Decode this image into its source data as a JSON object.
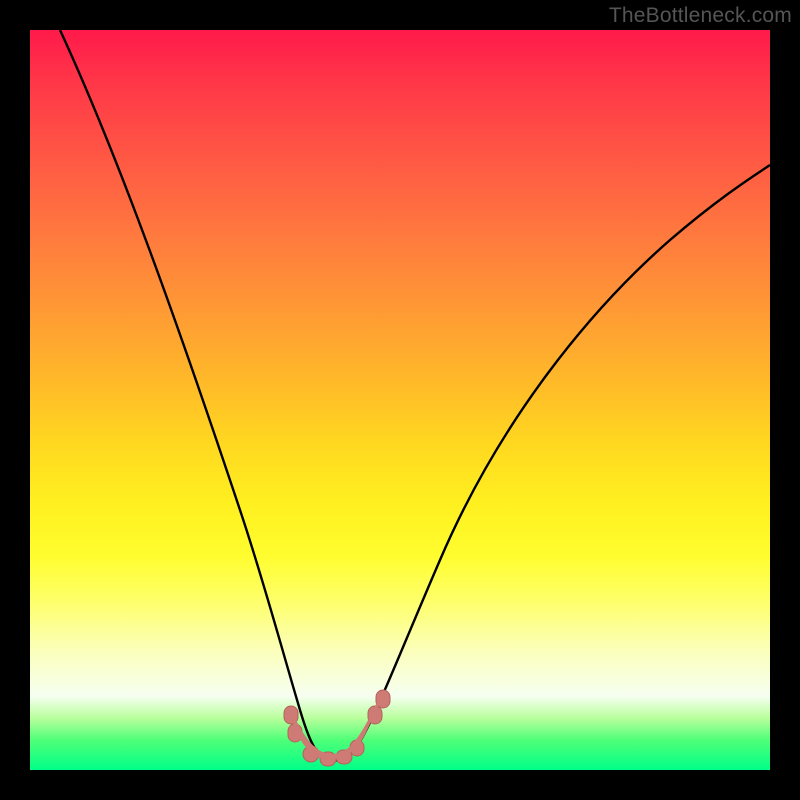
{
  "watermark": "TheBottleneck.com",
  "chart_data": {
    "type": "line",
    "title": "",
    "xlabel": "",
    "ylabel": "",
    "ylim": [
      0,
      100
    ],
    "series": [
      {
        "name": "curve",
        "x": [
          0.0,
          0.05,
          0.1,
          0.15,
          0.2,
          0.25,
          0.3,
          0.33,
          0.36,
          0.38,
          0.4,
          0.42,
          0.44,
          0.48,
          0.55,
          0.65,
          0.75,
          0.85,
          0.95,
          1.0
        ],
        "values": [
          100,
          92,
          82,
          71,
          58,
          43,
          25,
          12,
          5,
          2,
          1.5,
          2,
          5,
          11,
          21,
          34,
          46,
          56,
          65,
          69
        ]
      }
    ],
    "markers": {
      "x": [
        0.352,
        0.358,
        0.38,
        0.4,
        0.415,
        0.432,
        0.463,
        0.475
      ],
      "values": [
        6.5,
        5.2,
        2.0,
        1.5,
        1.8,
        3.2,
        7.8,
        9.8
      ]
    },
    "gradient_stops": [
      {
        "pct": 0,
        "color": "#ff1a4a"
      },
      {
        "pct": 50,
        "color": "#ffd820"
      },
      {
        "pct": 90,
        "color": "#f6fff1"
      },
      {
        "pct": 100,
        "color": "#00ff88"
      }
    ]
  }
}
